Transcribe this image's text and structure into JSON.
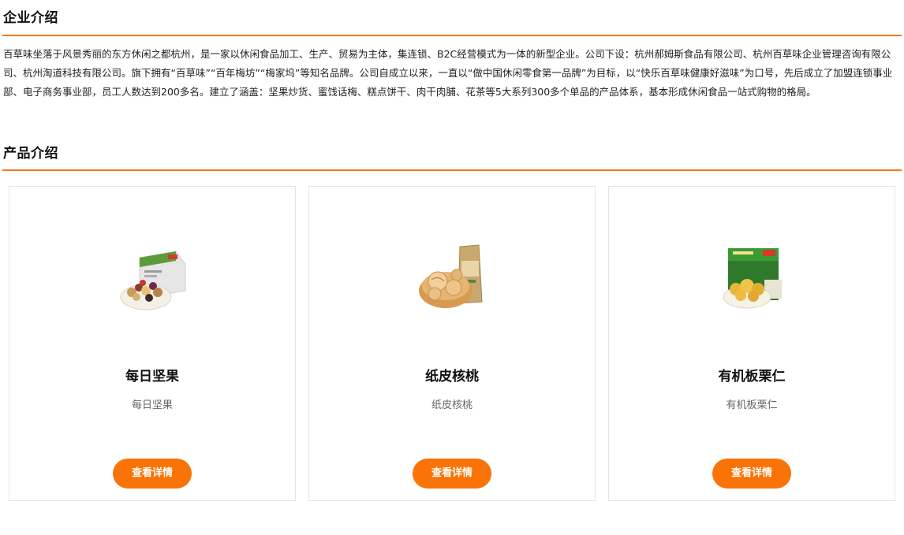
{
  "company": {
    "title": "企业介绍",
    "text": "百草味坐落于风景秀丽的东方休闲之都杭州，是一家以休闲食品加工、生产、贸易为主体，集连锁、B2C经营模式为一体的新型企业。公司下设：杭州郝姆斯食品有限公司、杭州百草味企业管理咨询有限公司、杭州淘道科技有限公司。旗下拥有“百草味”“百年梅坊”“梅家坞”等知名品牌。公司自成立以来，一直以“做中国休闲零食第一品牌”为目标，以“快乐百草味健康好滋味”为口号，先后成立了加盟连锁事业部、电子商务事业部，员工人数达到200多名。建立了涵盖：坚果炒货、蜜饯话梅、糕点饼干、肉干肉脯、花茶等5大系列300多个单品的产品体系，基本形成休闲食品一站式购物的格局。"
  },
  "products": {
    "title": "产品介绍",
    "items": [
      {
        "name": "每日坚果",
        "desc": "每日坚果",
        "button": "查看详情",
        "image": "mixed-nuts-box-image"
      },
      {
        "name": "纸皮核桃",
        "desc": "纸皮核桃",
        "button": "查看详情",
        "image": "walnuts-bag-image"
      },
      {
        "name": "有机板栗仁",
        "desc": "有机板栗仁",
        "button": "查看详情",
        "image": "chestnuts-package-image"
      }
    ]
  },
  "colors": {
    "accent": "#f07a1c",
    "button": "#f97306"
  }
}
